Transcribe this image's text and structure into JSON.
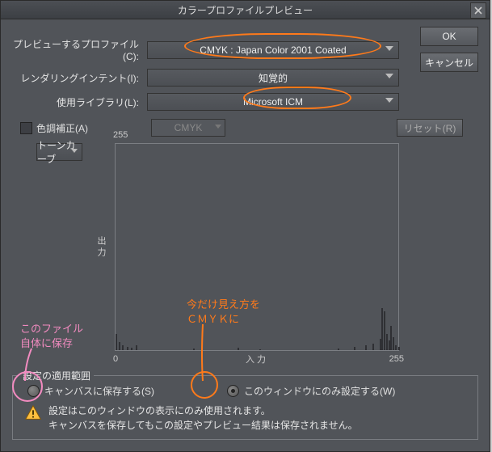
{
  "dialog": {
    "title": "カラープロファイルプレビュー",
    "ok": "OK",
    "cancel": "キャンセル"
  },
  "form": {
    "profile_label": "プレビューするプロファイル(C):",
    "profile_value": "CMYK : Japan Color 2001 Coated",
    "intent_label": "レンダリングインテント(I):",
    "intent_value": "知覚的",
    "library_label": "使用ライブラリ(L):",
    "library_value": "Microsoft ICM"
  },
  "adjust": {
    "color_correction_label": "色調補正(A)",
    "mode_value": "CMYK",
    "reset_label": "リセット(R)",
    "tone_curve_label": "トーンカーブ"
  },
  "chart_data": {
    "type": "bar",
    "title": "",
    "xlabel": "入力",
    "ylabel": "出力",
    "xlim": [
      0,
      255
    ],
    "ylim": [
      0,
      255
    ],
    "ticks_x": [
      "0",
      "255"
    ],
    "ticks_y": [
      "255"
    ],
    "histogram": [
      {
        "x": 0,
        "h": 20
      },
      {
        "x": 3,
        "h": 10
      },
      {
        "x": 6,
        "h": 6
      },
      {
        "x": 10,
        "h": 4
      },
      {
        "x": 14,
        "h": 3
      },
      {
        "x": 18,
        "h": 6
      },
      {
        "x": 70,
        "h": 2
      },
      {
        "x": 110,
        "h": 3
      },
      {
        "x": 130,
        "h": 1
      },
      {
        "x": 200,
        "h": 2
      },
      {
        "x": 215,
        "h": 4
      },
      {
        "x": 225,
        "h": 6
      },
      {
        "x": 232,
        "h": 8
      },
      {
        "x": 238,
        "h": 14
      },
      {
        "x": 240,
        "h": 52
      },
      {
        "x": 242,
        "h": 48
      },
      {
        "x": 244,
        "h": 20
      },
      {
        "x": 246,
        "h": 12
      },
      {
        "x": 248,
        "h": 30
      },
      {
        "x": 250,
        "h": 16
      },
      {
        "x": 252,
        "h": 6
      },
      {
        "x": 255,
        "h": 4
      }
    ]
  },
  "scope": {
    "legend": "設定の適用範囲",
    "radio_canvas": "キャンバスに保存する(S)",
    "radio_window": "このウィンドウにのみ設定する(W)",
    "warning_line1": "設定はこのウィンドウの表示にのみ使用されます。",
    "warning_line2": "キャンバスを保存してもこの設定やプレビュー結果は保存されません。"
  },
  "annotations": {
    "file_save_l1": "このファイル",
    "file_save_l2": "自体に保存",
    "temp_cmyk_l1": "今だけ見え方を",
    "temp_cmyk_l2": "ＣＭＹＫに"
  }
}
